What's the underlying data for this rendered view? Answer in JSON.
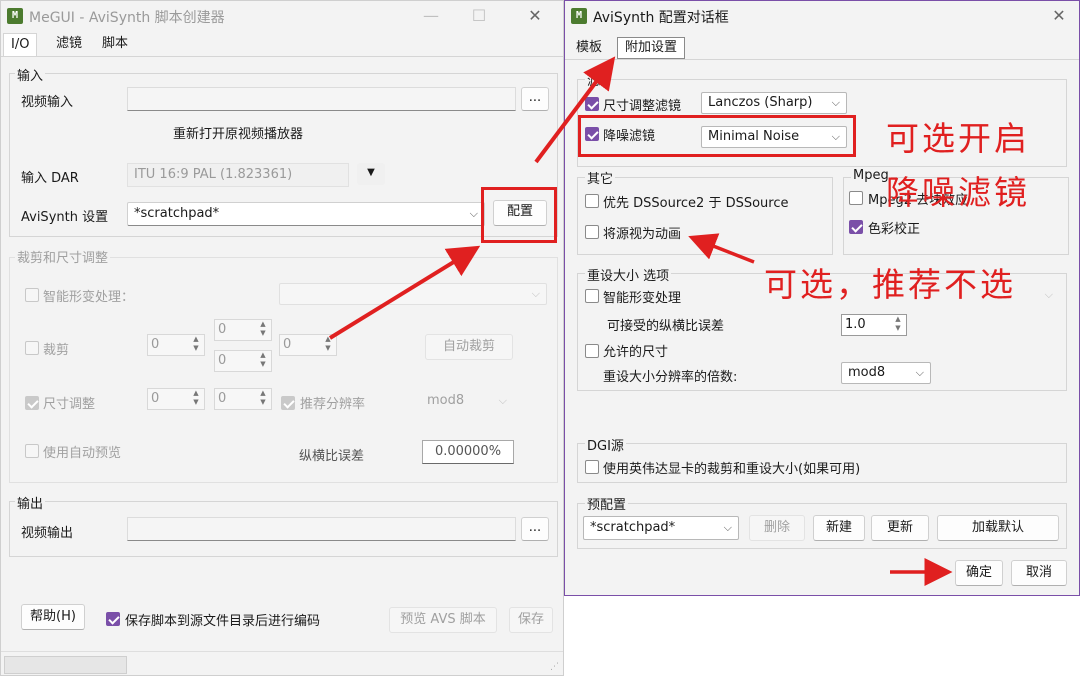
{
  "megui": {
    "title": "MeGUI - AviSynth 脚本创建器",
    "tabs": [
      "I/O",
      "滤镜",
      "脚本"
    ],
    "input_group": "输入",
    "video_input_label": "视频输入",
    "browse": "...",
    "reopen_player": "重新打开原视频播放器",
    "dar_label": "输入 DAR",
    "dar_value": "ITU 16:9 PAL (1.823361)",
    "avisynth_label": "AviSynth 设置",
    "avisynth_value": "*scratchpad*",
    "config_button": "配置",
    "crop_group": "裁剪和尺寸调整",
    "smart_deform": "智能形变处理：",
    "crop": "裁剪",
    "auto_crop": "自动裁剪",
    "resize": "尺寸调整",
    "recommend_res": "推荐分辨率",
    "mod": "mod8",
    "auto_preview": "使用自动预览",
    "aspect_error_label": "纵横比误差",
    "aspect_error_value": "0.00000%",
    "spin_zero": "0",
    "output_group": "输出",
    "video_output_label": "视频输出",
    "help_button": "帮助(H)",
    "save_encode": "保存脚本到源文件目录后进行编码",
    "preview_avs": "预览 AVS 脚本",
    "save_button": "保存"
  },
  "dialog": {
    "title": "AviSynth 配置对话框",
    "tabs": [
      "模板",
      "附加设置"
    ],
    "filters_group": "滤",
    "resize_filter_label": "尺寸调整滤镜",
    "resize_filter_value": "Lanczos (Sharp)",
    "denoise_label": "降噪滤镜",
    "denoise_value": "Minimal Noise",
    "other_group": "其它",
    "prefer_dss2": "优先 DSSource2 于 DSSource",
    "treat_anim": "将源视为动画",
    "mpeg_group": "Mpeg",
    "mpeg_deblock": "Mpeg2 去块效应",
    "color_correct": "色彩校正",
    "resize_opts_group": "重设大小 选项",
    "smart_deform": "智能形变处理",
    "accept_ar_error": "可接受的纵横比误差",
    "ar_error_value": "1.0",
    "allowed_size": "允许的尺寸",
    "resize_multiple_label": "重设大小分辨率的倍数:",
    "resize_multiple_value": "mod8",
    "dgi_group": "DGI源",
    "nvidia_crop": "使用英伟达显卡的裁剪和重设大小(如果可用)",
    "preset_group": "预配置",
    "preset_value": "*scratchpad*",
    "delete_button": "删除",
    "new_button": "新建",
    "update_button": "更新",
    "load_default_button": "加载默认",
    "ok_button": "确定",
    "cancel_button": "取消"
  },
  "annotations": {
    "optional_enable": "可选开启",
    "denoise_filter": "降噪滤镜",
    "optional_not_recommended": "可选，推荐不选"
  },
  "colors": {
    "annotation_red": "#e02020",
    "check_purple": "#7a4fa8",
    "dialog_border": "#7a4fa8"
  }
}
